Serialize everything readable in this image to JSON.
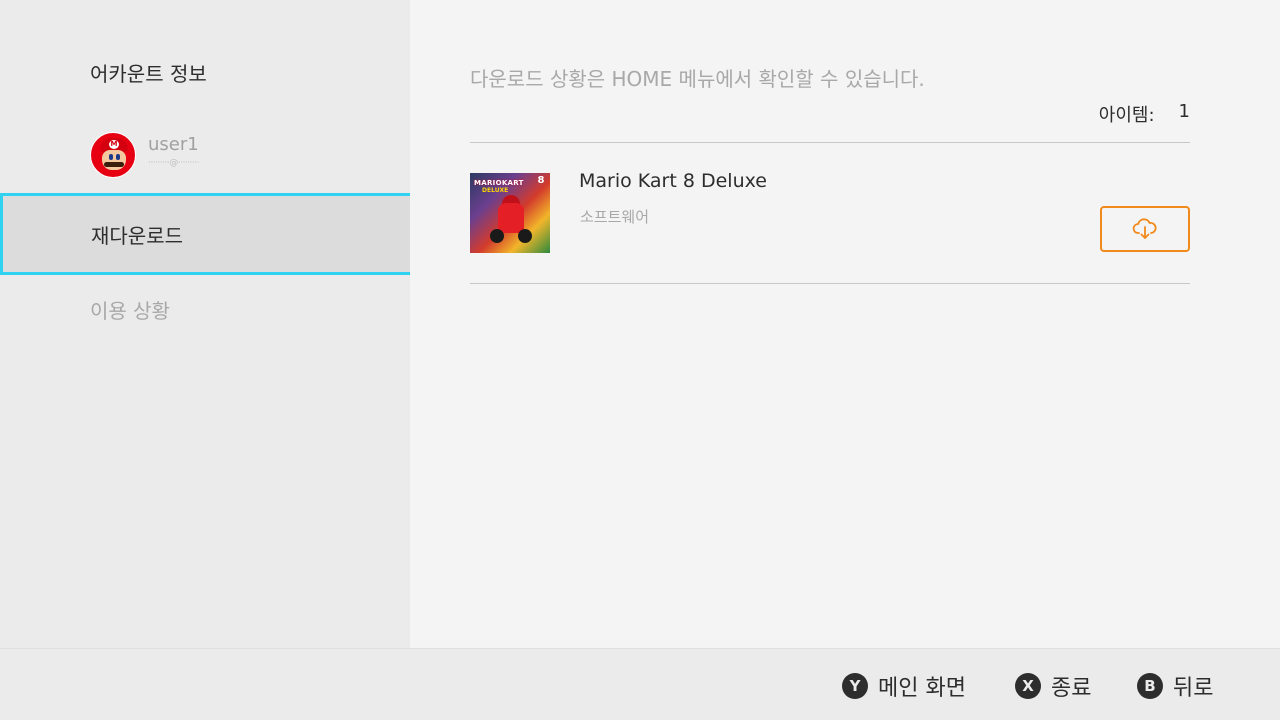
{
  "sidebar": {
    "heading": "어카운트 정보",
    "user": {
      "name": "user1",
      "email": "·········@·········"
    },
    "items": [
      {
        "label": "재다운로드",
        "selected": true
      },
      {
        "label": "이용 상황",
        "selected": false
      }
    ]
  },
  "main": {
    "notice": "다운로드 상황은 HOME 메뉴에서 확인할 수 있습니다.",
    "item_count_label": "아이템:",
    "item_count_value": "1",
    "games": [
      {
        "title": "Mario Kart 8 Deluxe",
        "type": "소프트웨어",
        "thumbnail_text": "MARIOKART",
        "thumbnail_sub": "DELUXE",
        "thumbnail_badge": "8",
        "action_icon": "cloud-download-icon"
      }
    ]
  },
  "footer": {
    "actions": [
      {
        "button": "Y",
        "label": "메인 화면"
      },
      {
        "button": "X",
        "label": "종료"
      },
      {
        "button": "B",
        "label": "뒤로"
      }
    ]
  },
  "colors": {
    "selection_border": "#2fd2f0",
    "download_accent": "#f18a1c",
    "avatar_red": "#e60012"
  }
}
